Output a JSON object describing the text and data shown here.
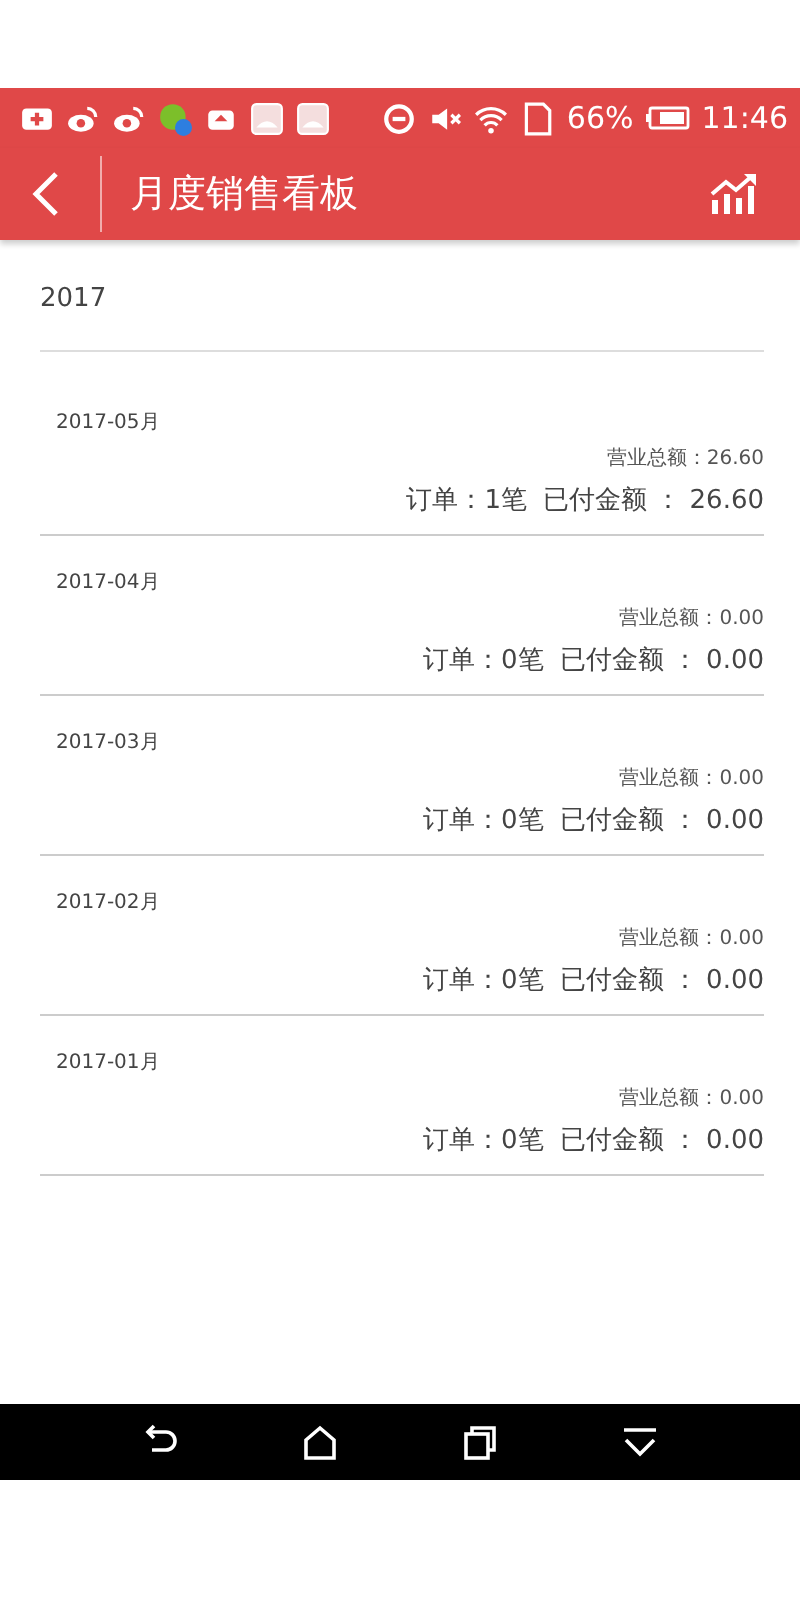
{
  "status_bar": {
    "battery": "66%",
    "time": "11:46"
  },
  "app_bar": {
    "title": "月度销售看板"
  },
  "year": "2017",
  "months": [
    {
      "month": "2017-05月",
      "total": "营业总额：26.60",
      "orders": "订单：1笔",
      "paid": "已付金额 ： 26.60"
    },
    {
      "month": "2017-04月",
      "total": "营业总额：0.00",
      "orders": "订单：0笔",
      "paid": "已付金额 ： 0.00"
    },
    {
      "month": "2017-03月",
      "total": "营业总额：0.00",
      "orders": "订单：0笔",
      "paid": "已付金额 ： 0.00"
    },
    {
      "month": "2017-02月",
      "total": "营业总额：0.00",
      "orders": "订单：0笔",
      "paid": "已付金额 ： 0.00"
    },
    {
      "month": "2017-01月",
      "total": "营业总额：0.00",
      "orders": "订单：0笔",
      "paid": "已付金额 ： 0.00"
    }
  ]
}
